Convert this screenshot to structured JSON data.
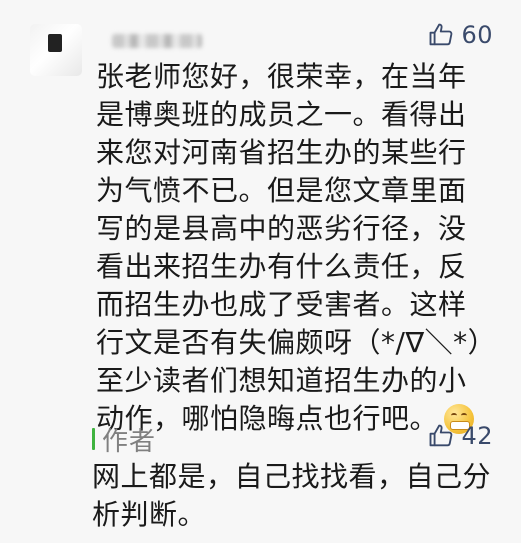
{
  "comment": {
    "nickname": "",
    "likes": "60",
    "text": "张老师您好，很荣幸，在当年是博奥班的成员之一。看得出来您对河南省招生办的某些行为气愤不已。但是您文章里面写的是县高中的恶劣行径，没看出来招生办有什么责任，反而招生办也成了受害者。这样行文是否有失偏颇呀（*/∇＼*）至少读者们想知道招生办的小动作，哪怕隐晦点也行吧。",
    "emoji": "zipper-mouth-face"
  },
  "reply": {
    "author_label": "作者",
    "likes": "42",
    "text": "网上都是，自己找找看，自己分析判断。"
  },
  "colors": {
    "accent_green": "#3fb33f",
    "like_color": "#3a4a6b"
  },
  "icons": {
    "like": "thumbs-up-icon"
  }
}
